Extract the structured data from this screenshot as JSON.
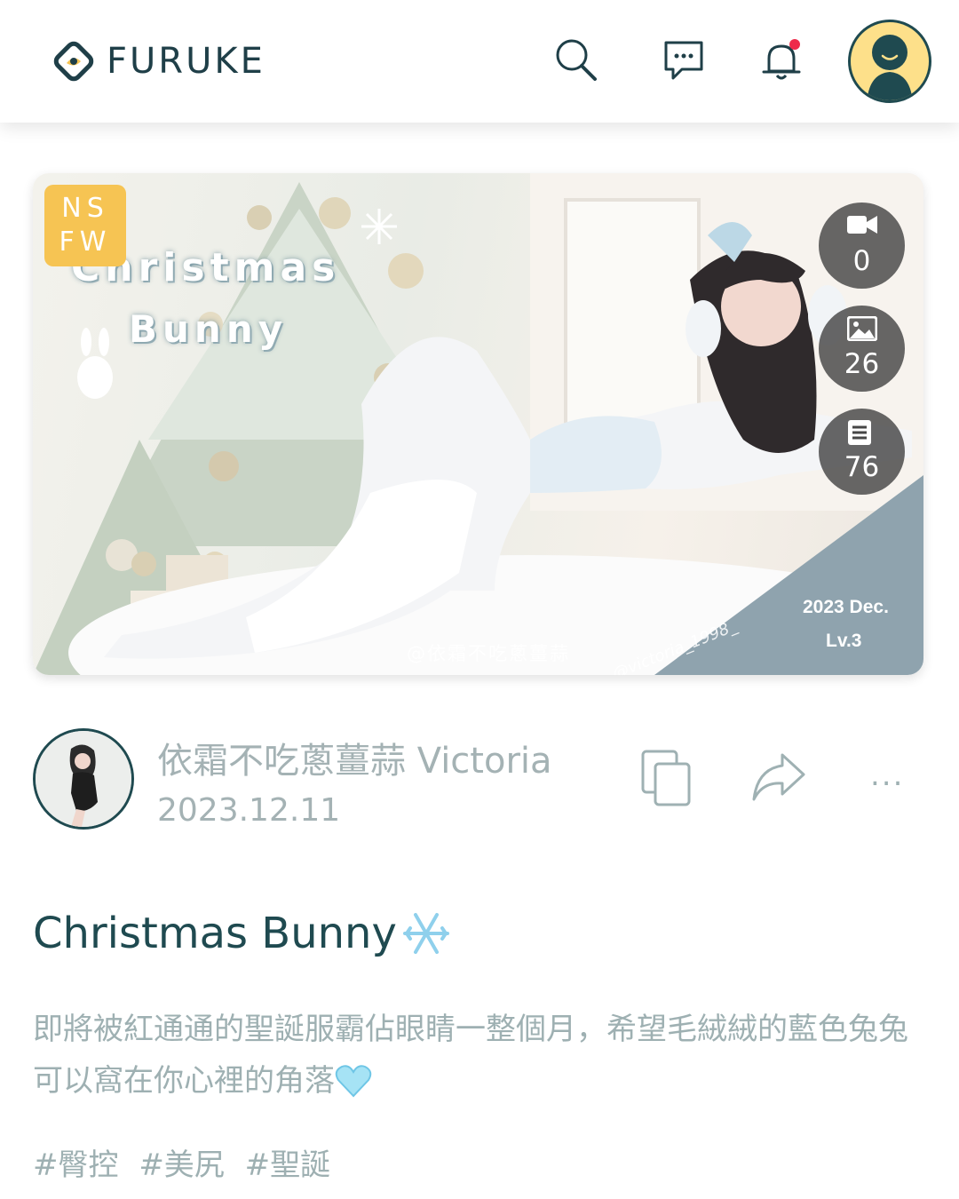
{
  "brand": {
    "name": "FURUKE"
  },
  "header": {
    "icons": [
      "search-icon",
      "chat-icon",
      "bell-icon",
      "user-avatar"
    ],
    "notification_dot_color": "#ee2a4a",
    "accent_yellow": "#fde08a"
  },
  "post": {
    "badge": {
      "line1": "NS",
      "line2": "FW",
      "color": "#f6c453"
    },
    "cover": {
      "title_line1": "Christmas",
      "title_line2": "Bunny",
      "date_label": "2023 Dec.",
      "level_label": "Lv.3",
      "watermark_name": "@依霜不吃蔥薑蒜",
      "watermark_handle": "@victoria_1998_"
    },
    "stats": {
      "videos": "0",
      "images": "26",
      "articles": "76"
    },
    "author": {
      "name": "依霜不吃蔥薑蒜 Victoria",
      "date": "2023.12.11"
    },
    "actions": [
      "copy-icon",
      "share-icon",
      "more-icon"
    ],
    "more_label": "...",
    "title": "Christmas Bunny",
    "title_emoji": "snowflake-icon",
    "body": "即將被紅通通的聖誕服霸佔眼睛一整個月，希望毛絨絨的藍色兔兔可以窩在你心裡的角落",
    "body_emoji": "light-blue-heart-icon",
    "tags": [
      "#臀控",
      "#美尻",
      "#聖誕"
    ]
  }
}
